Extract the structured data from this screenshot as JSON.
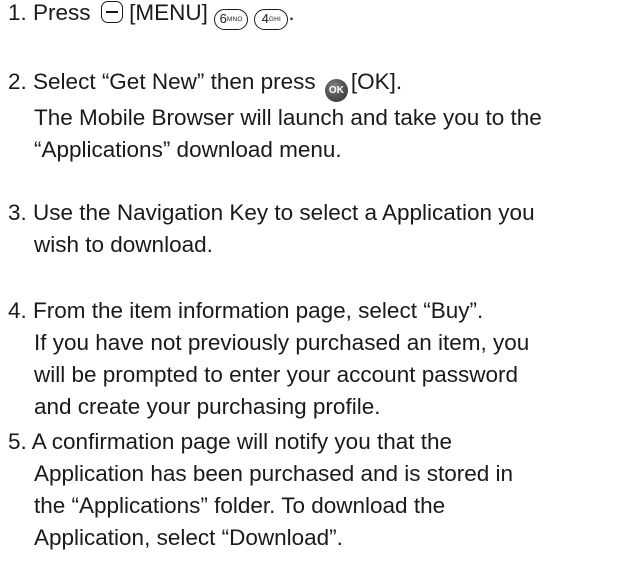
{
  "steps": [
    {
      "number": "1.",
      "lead": "Press",
      "menu_label": "[MENU]",
      "key6": {
        "digit": "6",
        "letters": "MNO"
      },
      "key4": {
        "digit": "4",
        "letters": "GHI"
      },
      "end": "."
    },
    {
      "number": "2.",
      "line1_a": "Select “Get New” then press",
      "ok_glyph": "OK",
      "line1_b": "[OK].",
      "line2": "The Mobile Browser will launch and take you to the",
      "line3": "“Applications” download menu."
    },
    {
      "number": "3.",
      "line1": "Use the Navigation Key to select a Application you",
      "line2": "wish to download."
    },
    {
      "number": "4.",
      "line1": "From the item information page, select “Buy”.",
      "line2": "If you have not previously purchased an item, you",
      "line3": "will be prompted to enter your account password",
      "line4": "and create your purchasing profile."
    },
    {
      "number": "5.",
      "line1": "A confirmation page will notify you that the",
      "line2": "Application has been purchased and is stored in",
      "line3": "the “Applications” folder. To download the",
      "line4": "Application, select “Download”."
    }
  ]
}
